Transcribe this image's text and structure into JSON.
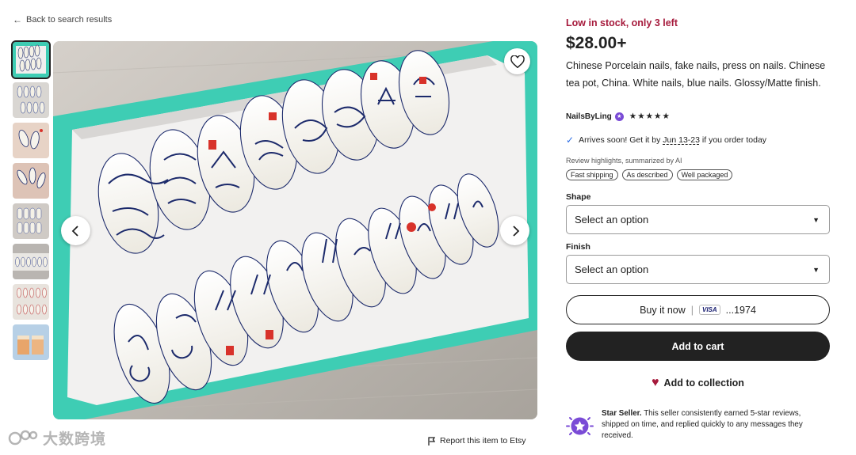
{
  "back_link": "Back to search results",
  "stock": "Low in stock, only 3 left",
  "price": "$28.00+",
  "description": "Chinese Porcelain nails, fake nails, press on nails. Chinese tea pot, China. White nails, blue nails. Glossy/Matte finish.",
  "seller": {
    "name": "NailsByLing",
    "stars": "★★★★★"
  },
  "arrival": {
    "prefix": "Arrives soon! Get it by",
    "dates": "Jun 13-23",
    "suffix": "if you order today"
  },
  "review_highlights": {
    "title": "Review highlights, summarized by AI",
    "chips": [
      "Fast shipping",
      "As described",
      "Well packaged"
    ]
  },
  "shape": {
    "label": "Shape",
    "value": "Select an option"
  },
  "finish": {
    "label": "Finish",
    "value": "Select an option"
  },
  "buy_now": {
    "label": "Buy it now",
    "card_brand": "VISA",
    "card_last": "...1974"
  },
  "add_to_cart": "Add to cart",
  "add_to_collection": "Add to collection",
  "star_seller": {
    "title": "Star Seller.",
    "text": "This seller consistently earned 5-star reviews, shipped on time, and replied quickly to any messages they received."
  },
  "report": "Report this item to Etsy",
  "watermark": "大数跨境",
  "colors": {
    "stock": "#a61a3c",
    "tray": "#3ecdb4",
    "ink": "#1c2a6b",
    "seal": "#d8322a"
  }
}
